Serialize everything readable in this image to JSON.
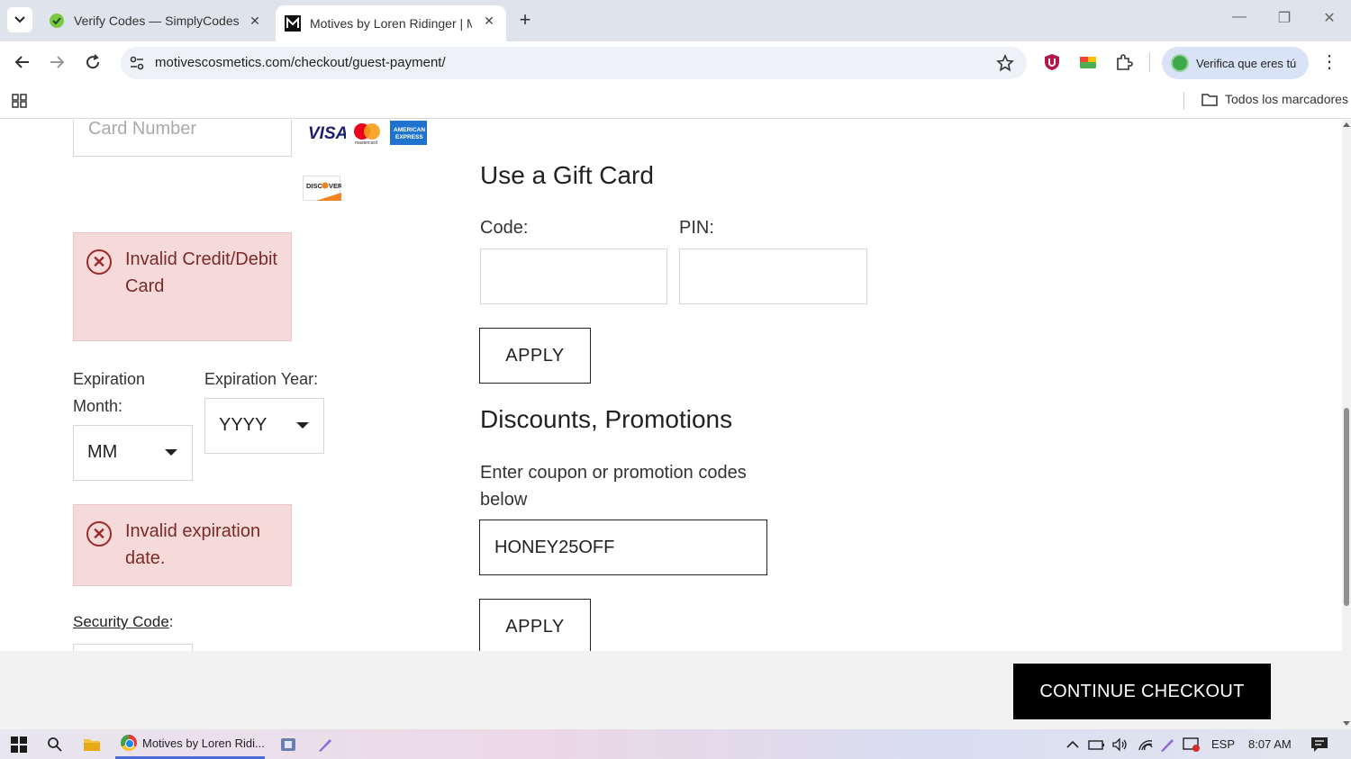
{
  "browser": {
    "tabs": [
      {
        "title": "Verify Codes — SimplyCodes",
        "active": false
      },
      {
        "title": "Motives by Loren Ridinger | Motives",
        "active": true
      }
    ],
    "url": "motivescosmetics.com/checkout/guest-payment/",
    "profile_pill": "Verifica que eres tú",
    "bookmarks_all": "Todos los marcadores"
  },
  "payment": {
    "card_number_placeholder": "Card Number",
    "card_logos": [
      "VISA",
      "mastercard",
      "AMERICAN EXPRESS",
      "DISCOVER"
    ],
    "card_error": "Invalid Credit/Debit Card",
    "exp_month_label": "Expiration Month:",
    "exp_month_value": "MM",
    "exp_year_label": "Expiration Year:",
    "exp_year_value": "YYYY",
    "exp_error": "Invalid expiration date.",
    "security_code_label": "Security Code",
    "security_code_colon": ":"
  },
  "gift_card": {
    "heading": "Use a Gift Card",
    "code_label": "Code:",
    "pin_label": "PIN:",
    "apply_label": "APPLY"
  },
  "discounts": {
    "heading": "Discounts, Promotions",
    "instruction": "Enter coupon or promotion codes below",
    "coupon_value": "HONEY25OFF",
    "apply_label": "APPLY"
  },
  "checkout": {
    "continue_label": "CONTINUE CHECKOUT"
  },
  "taskbar": {
    "app_title": "Motives by Loren Ridi...",
    "language": "ESP",
    "time": "8:07 AM"
  },
  "colors": {
    "error_bg": "#f6d9d9",
    "error_text": "#7b2a2a",
    "checkout_button": "#000000"
  }
}
